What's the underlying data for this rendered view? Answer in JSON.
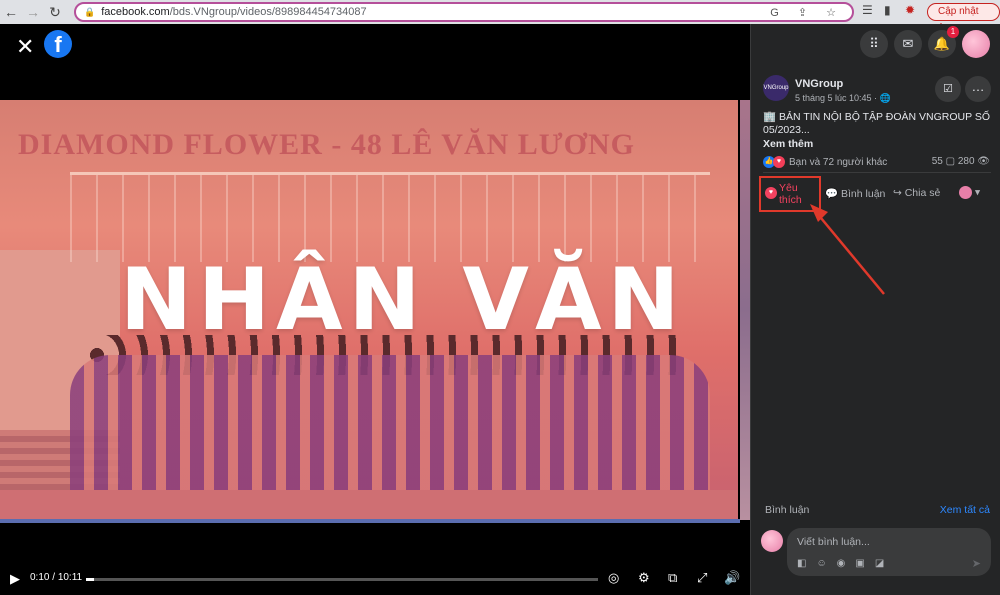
{
  "browser": {
    "url_host": "facebook.com",
    "url_path": "/bds.VNgroup/videos/898984454734087",
    "update_label": "Cập nhật"
  },
  "video": {
    "banner_text": "DIAMOND FLOWER - 48 LÊ VĂN LƯƠNG",
    "title_overlay": "NHÂN VĂN",
    "time_current": "0:10",
    "time_total": "10:11",
    "progress_fraction": 0.016
  },
  "nav": {
    "notification_count": "1"
  },
  "post": {
    "author": "VNGroup",
    "timestamp": "5 tháng 5 lúc 10:45 · ",
    "text": "BẢN TIN NỘI BỘ TẬP ĐOÀN VNGROUP SỐ 05/2023...",
    "see_more": "Xem thêm",
    "reactions_text": "Bạn và 72 người khác",
    "comments_count": "55",
    "views_count": "280"
  },
  "actions": {
    "like_label": "Yêu thích",
    "comment_label": "Bình luận",
    "share_label": "Chia sẻ"
  },
  "comments": {
    "header": "Bình luận",
    "see_all": "Xem tất cả",
    "placeholder": "Viết bình luận..."
  }
}
